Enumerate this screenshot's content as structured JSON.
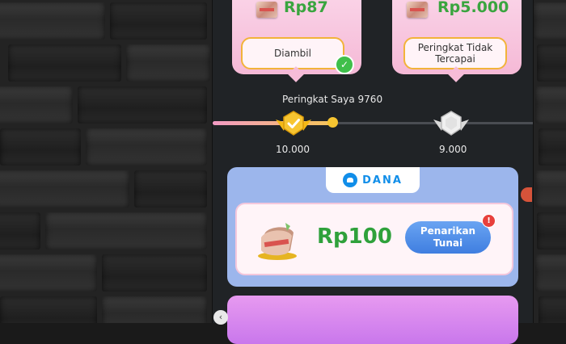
{
  "tiers": [
    {
      "amount": "Rp87",
      "button_label": "Diambil",
      "claimed": true
    },
    {
      "amount": "Rp5.000",
      "button_label": "Peringkat Tidak Tercapai",
      "claimed": false
    }
  ],
  "my_rank_label": "Peringkat Saya 9760",
  "rank_marks": [
    "10.000",
    "9.000"
  ],
  "dana_card": {
    "brand": "DANA",
    "amount": "Rp100",
    "cash_button": "Penarikan Tunai",
    "alert_badge": "!"
  },
  "icons": {
    "check": "✓",
    "back_arrow": "‹"
  },
  "colors": {
    "accent_green": "#3aa53f",
    "dana_blue": "#118ee9",
    "button_blue": "#3f7ee0"
  }
}
